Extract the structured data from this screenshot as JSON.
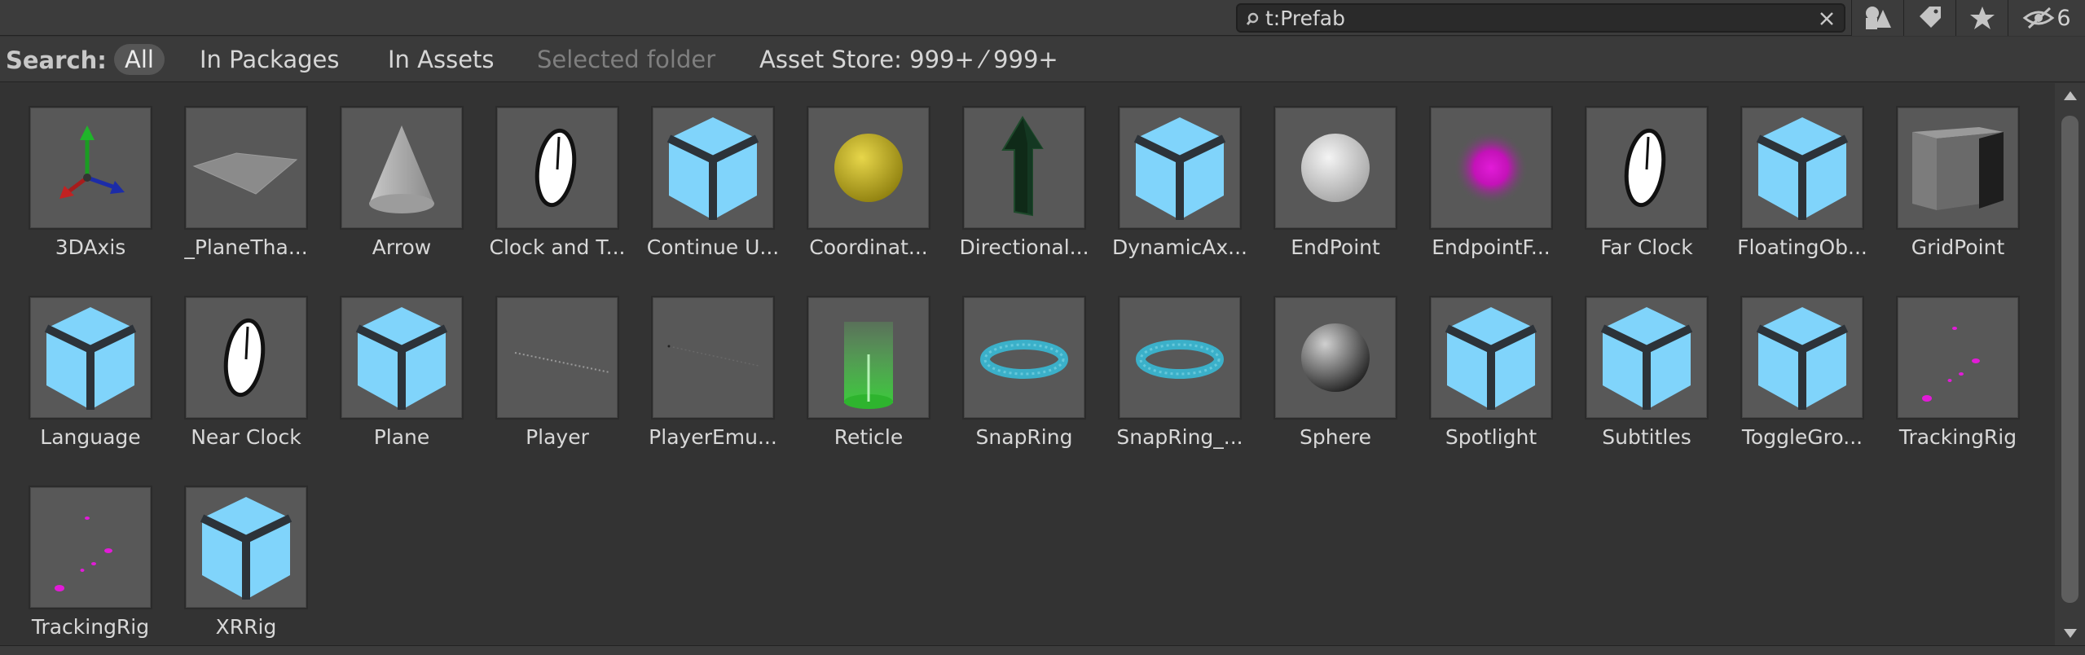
{
  "search": {
    "value": "t:Prefab",
    "placeholder": ""
  },
  "toolbar": {
    "buttons": [
      {
        "name": "shapes-filter-icon"
      },
      {
        "name": "label-filter-icon"
      },
      {
        "name": "favorite-star-icon"
      },
      {
        "name": "hidden-packages-icon",
        "count": "6"
      }
    ]
  },
  "scope": {
    "label": "Search:",
    "options": [
      "All",
      "In Packages",
      "In Assets",
      "Selected folder",
      "Asset Store: 999+ ⁄ 999+"
    ],
    "active": "All",
    "disabled": "Selected folder"
  },
  "assets": [
    {
      "label": "3DAxis",
      "icon": "axis-gizmo-icon"
    },
    {
      "label": "_PlaneTha...",
      "icon": "plane-icon"
    },
    {
      "label": "Arrow",
      "icon": "cone-icon"
    },
    {
      "label": "Clock and T...",
      "icon": "clock-icon"
    },
    {
      "label": "Continue U...",
      "icon": "prefab-cube-icon"
    },
    {
      "label": "Coordinat...",
      "icon": "yellow-sphere-icon"
    },
    {
      "label": "Directional...",
      "icon": "green-arrow-icon"
    },
    {
      "label": "DynamicAx...",
      "icon": "prefab-cube-icon"
    },
    {
      "label": "EndPoint",
      "icon": "white-sphere-icon"
    },
    {
      "label": "EndpointF...",
      "icon": "magenta-glow-icon"
    },
    {
      "label": "Far Clock",
      "icon": "clock-icon"
    },
    {
      "label": "FloatingOb...",
      "icon": "prefab-cube-icon"
    },
    {
      "label": "GridPoint",
      "icon": "grey-cube-icon"
    },
    {
      "label": "Language",
      "icon": "prefab-cube-icon"
    },
    {
      "label": "Near Clock",
      "icon": "clock-icon"
    },
    {
      "label": "Plane",
      "icon": "prefab-cube-icon"
    },
    {
      "label": "Player",
      "icon": "dotted-line-icon"
    },
    {
      "label": "PlayerEmu...",
      "icon": "faint-line-icon"
    },
    {
      "label": "Reticle",
      "icon": "green-beam-icon"
    },
    {
      "label": "SnapRing",
      "icon": "torus-icon"
    },
    {
      "label": "SnapRing_...",
      "icon": "torus-icon"
    },
    {
      "label": "Sphere",
      "icon": "grey-sphere-icon"
    },
    {
      "label": "Spotlight",
      "icon": "prefab-cube-icon"
    },
    {
      "label": "Subtitles",
      "icon": "prefab-cube-icon"
    },
    {
      "label": "ToggleGro...",
      "icon": "prefab-cube-icon"
    },
    {
      "label": "TrackingRig",
      "icon": "magenta-dots-icon"
    },
    {
      "label": "TrackingRig",
      "icon": "magenta-dots-icon"
    },
    {
      "label": "XRRig",
      "icon": "prefab-cube-icon"
    }
  ],
  "colors": {
    "background": "#333333",
    "prefab_blue": "#80d4fb",
    "prefab_dark": "#2d3339",
    "thumb_bg": "#585858",
    "magenta": "#e21bd8"
  }
}
